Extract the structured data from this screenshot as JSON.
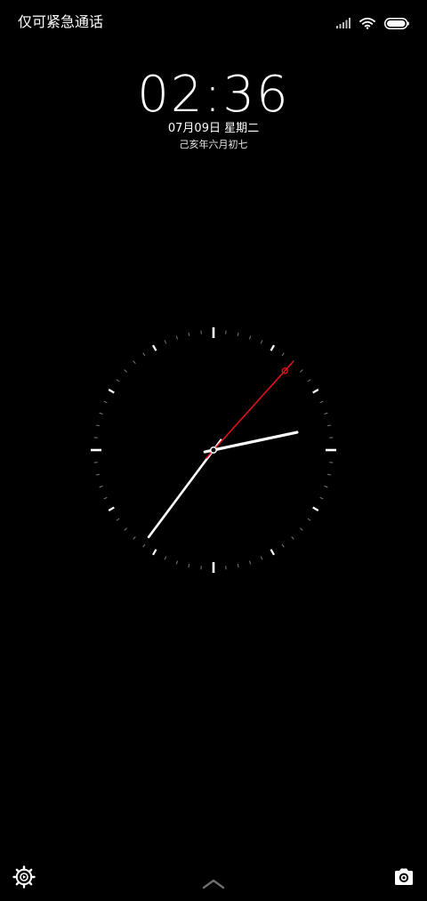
{
  "status_bar": {
    "carrier_text": "仅可紧急通话",
    "icons": [
      "signal-icon",
      "wifi-icon",
      "battery-icon"
    ]
  },
  "lock_screen": {
    "time": "02:36",
    "date": "07月09日 星期二",
    "lunar_date": "己亥年六月初七"
  },
  "analog_clock": {
    "hours": 2,
    "minutes": 36,
    "seconds": 7,
    "hand_color": "#ffffff",
    "second_hand_color": "#e0101a"
  },
  "bottom_bar": {
    "left_icon": "settings-gear-icon",
    "center_icon": "chevron-up-icon",
    "right_icon": "camera-icon"
  }
}
